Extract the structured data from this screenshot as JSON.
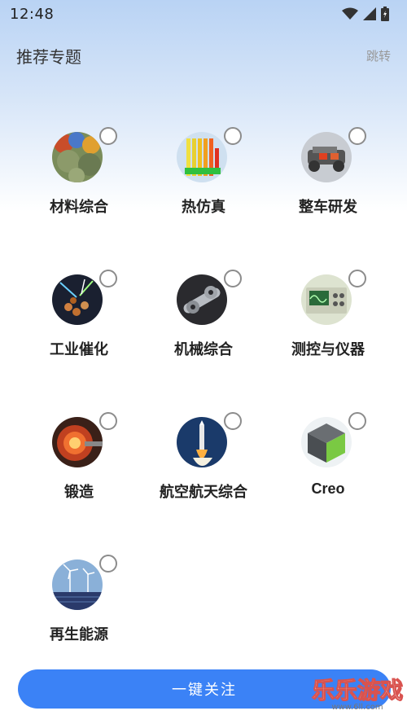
{
  "status_bar": {
    "time": "12:48"
  },
  "header": {
    "title": "推荐专题",
    "skip_label": "跳转"
  },
  "topics": [
    {
      "label": "材料综合",
      "image": "materials-image",
      "selected": false
    },
    {
      "label": "热仿真",
      "image": "thermal-sim-image",
      "selected": false
    },
    {
      "label": "整车研发",
      "image": "vehicle-rd-image",
      "selected": false
    },
    {
      "label": "工业催化",
      "image": "catalysis-image",
      "selected": false
    },
    {
      "label": "机械综合",
      "image": "mechanical-image",
      "selected": false
    },
    {
      "label": "测控与仪器",
      "image": "instrument-image",
      "selected": false
    },
    {
      "label": "锻造",
      "image": "forging-image",
      "selected": false
    },
    {
      "label": "航空航天综合",
      "image": "aerospace-image",
      "selected": false
    },
    {
      "label": "Creo",
      "image": "creo-cube-image",
      "selected": false
    },
    {
      "label": "再生能源",
      "image": "renewable-energy-image",
      "selected": false
    }
  ],
  "follow_button": {
    "label": "一键关注"
  },
  "watermark": {
    "text": "乐乐游戏",
    "url": "www.6ll.com"
  },
  "colors": {
    "accent": "#3b82f6",
    "header_gradient_top": "#b9d3f4"
  }
}
